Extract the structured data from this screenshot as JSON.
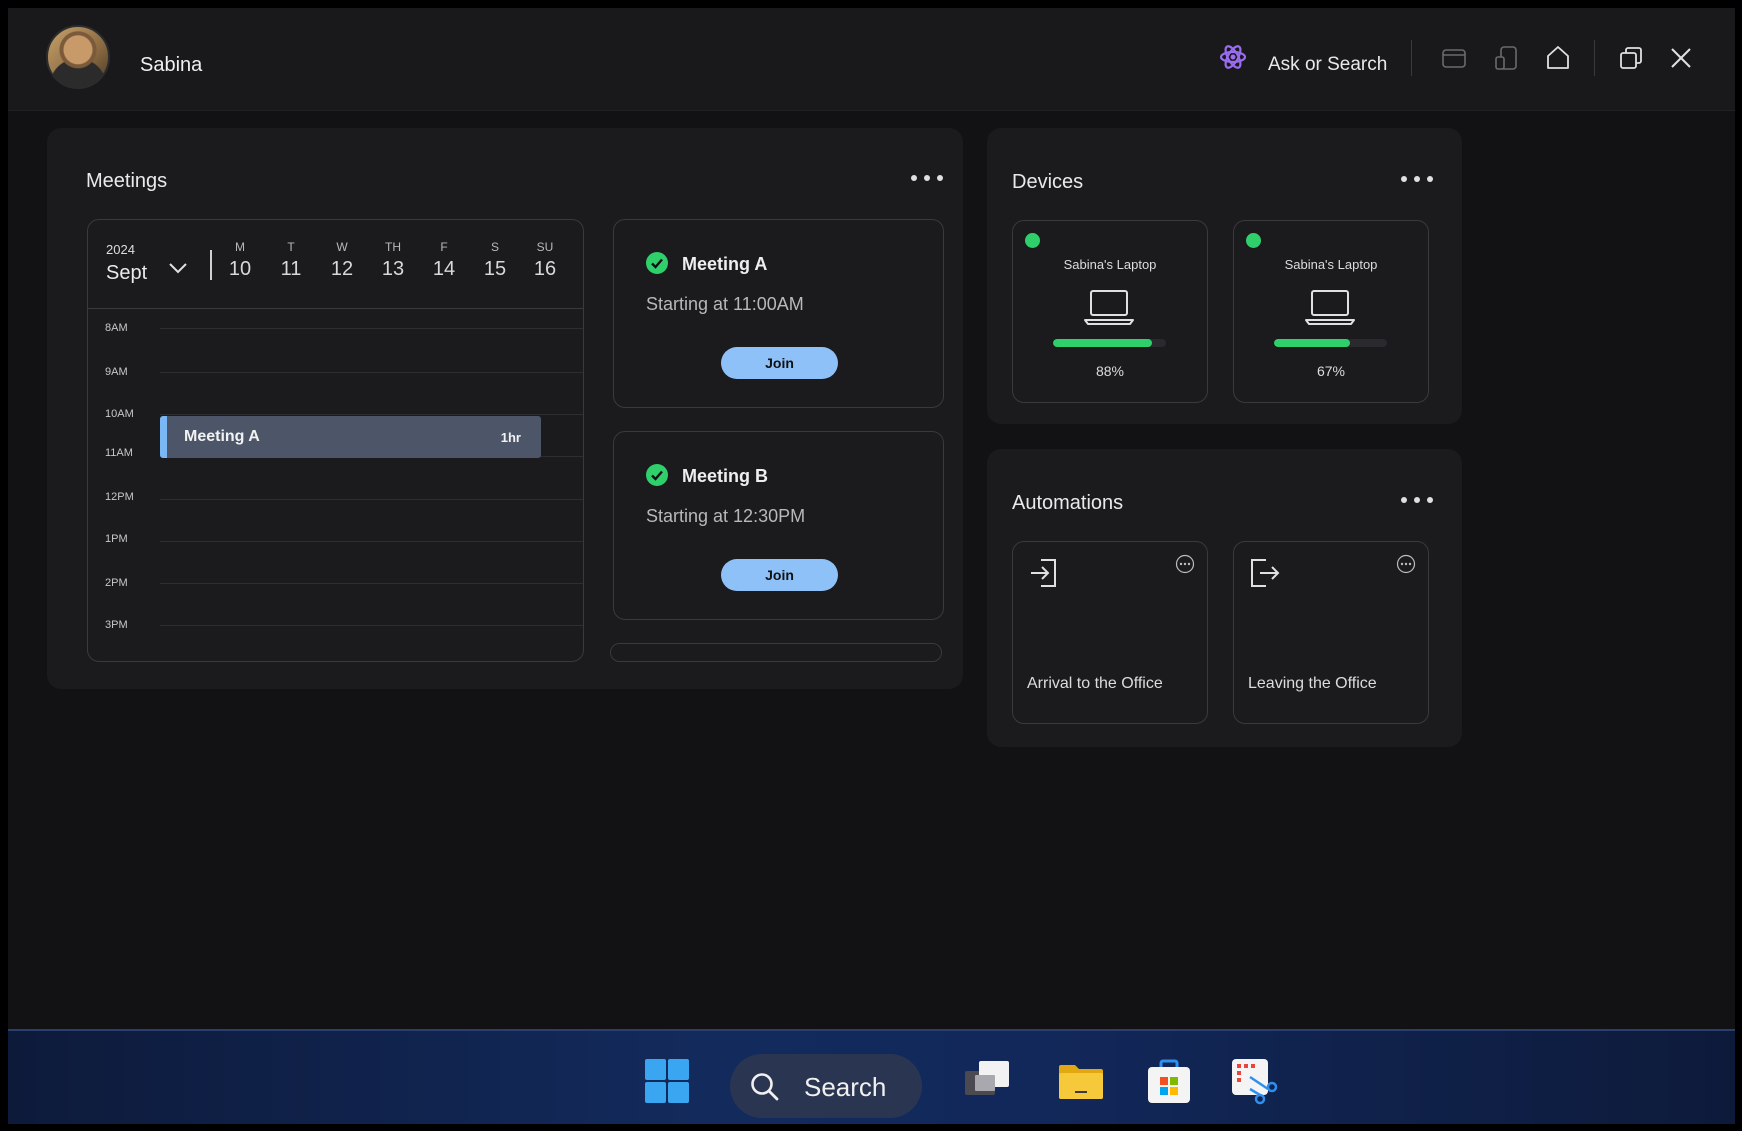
{
  "header": {
    "user_name": "Sabina",
    "ask_label": "Ask or Search"
  },
  "meetings": {
    "title": "Meetings",
    "calendar": {
      "year": "2024",
      "month": "Sept",
      "days": [
        {
          "letter": "M",
          "num": "10"
        },
        {
          "letter": "T",
          "num": "11"
        },
        {
          "letter": "W",
          "num": "12"
        },
        {
          "letter": "TH",
          "num": "13"
        },
        {
          "letter": "F",
          "num": "14"
        },
        {
          "letter": "S",
          "num": "15"
        },
        {
          "letter": "SU",
          "num": "16"
        }
      ],
      "hours": [
        "8AM",
        "9AM",
        "10AM",
        "11AM",
        "12PM",
        "1PM",
        "2PM",
        "3PM"
      ],
      "event": {
        "title": "Meeting A",
        "duration": "1hr"
      }
    },
    "cards": [
      {
        "title": "Meeting A",
        "time": "Starting at 11:00AM",
        "action": "Join"
      },
      {
        "title": "Meeting B",
        "time": "Starting at 12:30PM",
        "action": "Join"
      }
    ]
  },
  "devices": {
    "title": "Devices",
    "items": [
      {
        "name": "Sabina's Laptop",
        "battery": "88%",
        "battery_value": 0.88,
        "status_color": "#2fd06b"
      },
      {
        "name": "Sabina's Laptop",
        "battery": "67%",
        "battery_value": 0.67,
        "status_color": "#2fd06b"
      }
    ]
  },
  "automations": {
    "title": "Automations",
    "items": [
      {
        "label": "Arrival to the Office",
        "icon": "login-icon"
      },
      {
        "label": "Leaving the Office",
        "icon": "logout-icon"
      }
    ]
  },
  "taskbar": {
    "search_label": "Search",
    "apps": [
      "start-icon",
      "task-view-icon",
      "file-explorer-icon",
      "store-icon",
      "snipping-tool-icon"
    ]
  },
  "colors": {
    "accent_blue": "#8ec1f7",
    "success_green": "#2fd06b",
    "event_bg": "#4c5668"
  }
}
